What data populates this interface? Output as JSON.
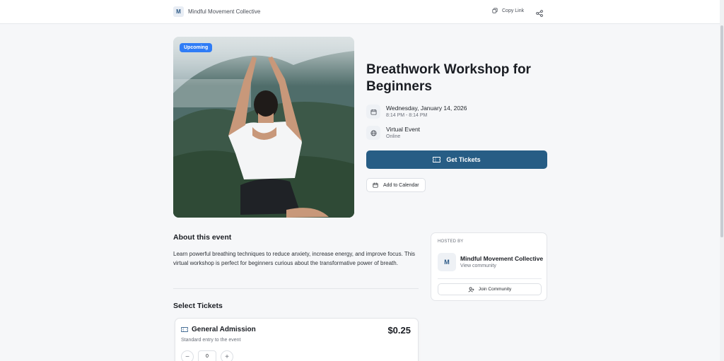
{
  "header": {
    "brand_initial": "M",
    "brand_name": "Mindful Movement Collective",
    "copy_link_label": "Copy Link",
    "icons": {
      "copy": "copy-icon",
      "share": "share-icon"
    }
  },
  "event": {
    "status_badge": "Upcoming",
    "title": "Breathwork Workshop for Beginners",
    "date": "Wednesday, January 14, 2026",
    "time": "8:14 PM - 8:14 PM",
    "location": "Virtual Event",
    "location_sub": "Online",
    "get_tickets_label": "Get Tickets",
    "add_calendar_label": "Add to Calendar",
    "icons": {
      "date": "calendar-icon",
      "location": "globe-icon",
      "ticket": "ticket-icon",
      "add_calendar": "calendar-plus-icon"
    }
  },
  "about": {
    "heading": "About this event",
    "description": "Learn powerful breathing techniques to reduce anxiety, increase energy, and improve focus. This virtual workshop is perfect for beginners curious about the transformative power of breath."
  },
  "tickets": {
    "heading": "Select Tickets",
    "items": [
      {
        "name": "General Admission",
        "price": "$0.25",
        "description": "Standard entry to the event",
        "quantity": "0",
        "minus": "−",
        "plus": "+"
      }
    ]
  },
  "host": {
    "label": "HOSTED BY",
    "avatar_initial": "M",
    "name": "Mindful Movement Collective",
    "view_label": "View community",
    "join_label": "Join Community",
    "icons": {
      "join": "user-plus-icon"
    }
  },
  "colors": {
    "accent": "#275d85",
    "badge": "#2f7cf6",
    "background": "#f6f7f9"
  }
}
